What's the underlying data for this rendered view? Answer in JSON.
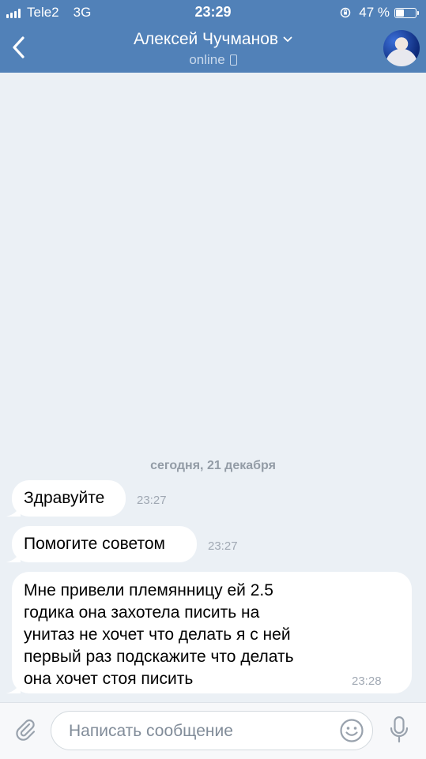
{
  "status_bar": {
    "carrier": "Tele2",
    "network": "3G",
    "time": "23:29",
    "battery_percent": "47 %",
    "battery_level": 0.47
  },
  "header": {
    "contact_name": "Алексей Чучманов",
    "presence": "online"
  },
  "chat": {
    "date_separator": "сегодня, 21 декабря",
    "messages": [
      {
        "lines": [
          "Здравуйте"
        ],
        "time": "23:27"
      },
      {
        "lines": [
          "Помогите советом"
        ],
        "time": "23:27"
      },
      {
        "lines": [
          "Мне привели племянницу ей 2.5",
          "годика она захотела писить на",
          "унитаз не хочет что делать я с ней",
          "первый раз подскажите что делать",
          "она хочет стоя писить"
        ],
        "time": "23:28"
      }
    ]
  },
  "composer": {
    "placeholder": "Написать сообщение"
  },
  "colors": {
    "header_bg": "#5181b8",
    "chat_bg": "#ebf0f5",
    "bubble_bg": "#ffffff"
  }
}
